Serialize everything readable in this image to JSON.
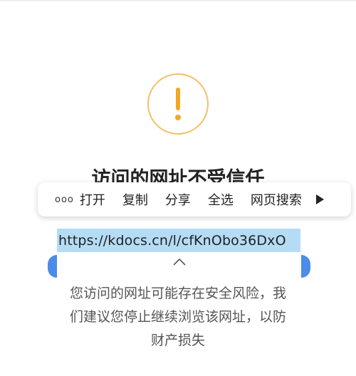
{
  "icons": {
    "warning": "exclamation-icon",
    "more": "more-dots-icon",
    "expand": "arrow-right-icon",
    "caret": "chevron-up-icon"
  },
  "colors": {
    "warning_accent": "#f5a623",
    "selection_highlight": "#b5dcf5",
    "selection_handle": "#4a8ce8"
  },
  "page": {
    "title": "访问的网址不受信任",
    "url": "https://kdocs.cn/l/cfKnObo36DxO",
    "description_line1": "您访问的网址可能存在安全风险，我",
    "description_line2": "们建议您停止继续浏览该网址，以防",
    "description_line3": "财产损失"
  },
  "context_menu": {
    "more": "ooo",
    "items": [
      {
        "label": "打开"
      },
      {
        "label": "复制"
      },
      {
        "label": "分享"
      },
      {
        "label": "全选"
      },
      {
        "label": "网页搜索"
      }
    ]
  }
}
